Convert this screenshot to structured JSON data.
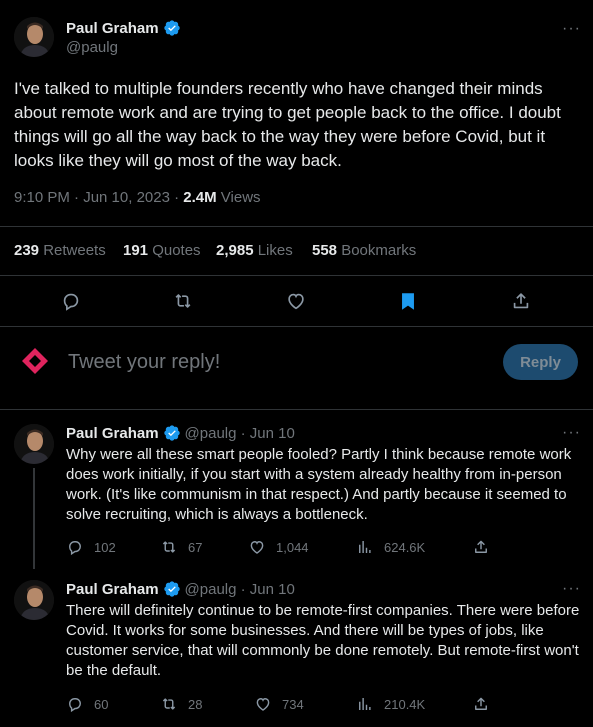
{
  "main_tweet": {
    "author_name": "Paul Graham",
    "author_handle": "@paulg",
    "text": "I've talked to multiple founders recently who have changed their minds about remote work and are trying to get people back to the office. I doubt things will go all the way back to the way they were before Covid, but it looks like they will go most of the way back.",
    "time": "9:10 PM · Jun 10, 2023 · ",
    "views_count": "2.4M",
    "views_label": " Views",
    "stats": {
      "retweets_count": "239",
      "retweets_label": " Retweets",
      "quotes_count": "191",
      "quotes_label": " Quotes",
      "likes_count": "2,985",
      "likes_label": " Likes",
      "bookmarks_count": "558",
      "bookmarks_label": " Bookmarks"
    },
    "more_label": "···"
  },
  "composer": {
    "placeholder": "Tweet your reply!",
    "button_label": "Reply"
  },
  "replies": [
    {
      "author_name": "Paul Graham",
      "author_handle": "@paulg · Jun 10",
      "text": "Why were all these smart people fooled? Partly I think because remote work does work initially, if you start with a system already healthy from in-person work. (It's like communism in that respect.) And partly because it seemed to solve recruiting, which is always a bottleneck.",
      "replies_count": "102",
      "retweets_count": "67",
      "likes_count": "1,044",
      "views_count": "624.6K",
      "more_label": "···"
    },
    {
      "author_name": "Paul Graham",
      "author_handle": "@paulg · Jun 10",
      "text": "There will definitely continue to be remote-first companies. There were before Covid. It works for some businesses. And there will be types of jobs, like customer service, that will commonly be done remotely. But remote-first won't be the default.",
      "replies_count": "60",
      "retweets_count": "28",
      "likes_count": "734",
      "views_count": "210.4K",
      "more_label": "···"
    }
  ],
  "colors": {
    "accent": "#1d9bf0",
    "brand_logo": "#e0245e",
    "muted": "#71767b",
    "divider": "#2f3336"
  },
  "icons": {
    "verified": "verified-badge-icon",
    "reply": "reply-icon",
    "retweet": "retweet-icon",
    "like": "heart-icon",
    "bookmark": "bookmark-icon",
    "share": "share-icon",
    "views": "views-icon"
  }
}
